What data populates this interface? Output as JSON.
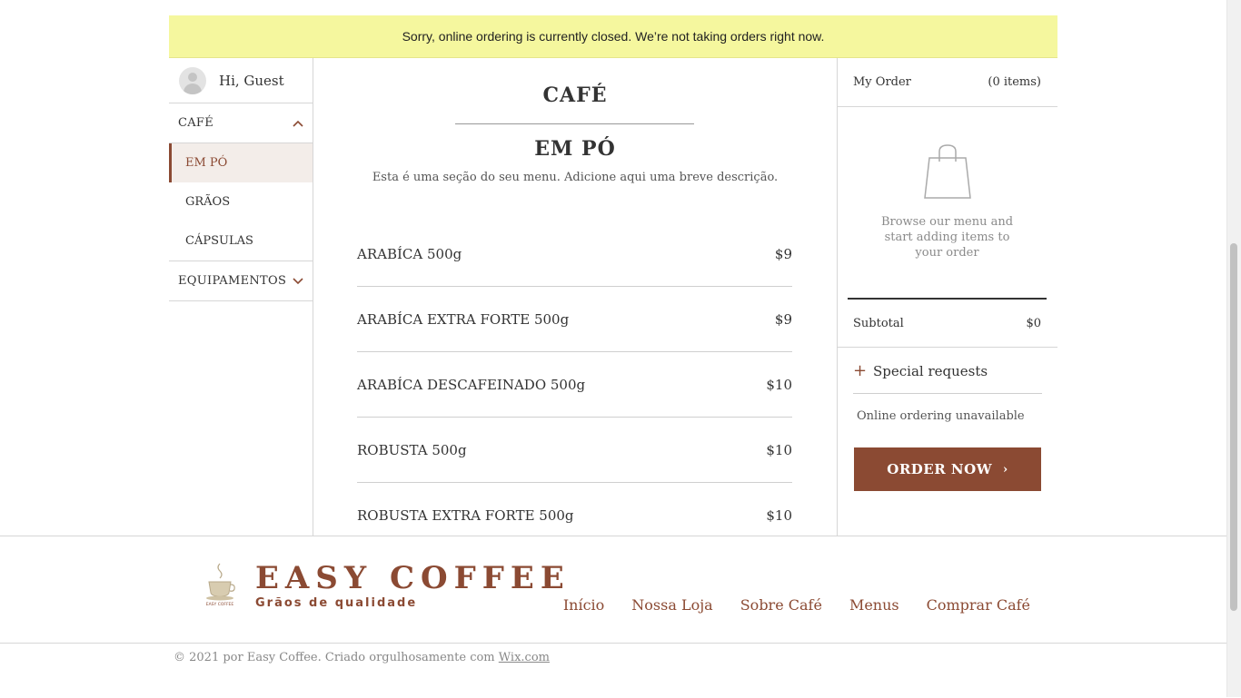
{
  "notice": "Sorry, online ordering is currently closed. We’re not taking orders right now.",
  "sidebar": {
    "greeting": "Hi, Guest",
    "categories": [
      {
        "label": "CAFÉ",
        "expanded": true
      },
      {
        "label": "EQUIPAMENTOS",
        "expanded": false
      }
    ],
    "subitems": [
      {
        "label": "EM PÓ",
        "active": true
      },
      {
        "label": "GRÃOS",
        "active": false
      },
      {
        "label": "CÁPSULAS",
        "active": false
      }
    ]
  },
  "menu": {
    "title": "CAFÉ",
    "section_title": "EM PÓ",
    "section_description": "Esta é uma seção do seu menu. Adicione aqui uma breve descrição.",
    "items": [
      {
        "name": "ARABÍCA 500g",
        "price": "$9"
      },
      {
        "name": "ARABÍCA EXTRA FORTE 500g",
        "price": "$9"
      },
      {
        "name": "ARABÍCA DESCAFEINADO 500g",
        "price": "$10"
      },
      {
        "name": "ROBUSTA 500g",
        "price": "$10"
      },
      {
        "name": "ROBUSTA EXTRA FORTE 500g",
        "price": "$10"
      }
    ]
  },
  "order": {
    "title": "My Order",
    "count": "(0 items)",
    "empty_message": "Browse our menu and start adding items to your order",
    "subtotal_label": "Subtotal",
    "subtotal_value": "$0",
    "special_requests": "Special requests",
    "unavailable": "Online ordering unavailable",
    "order_button": "ORDER NOW"
  },
  "footer": {
    "logo_title": "EASY COFFEE",
    "logo_subtitle": "Grãos de qualidade",
    "logo_small": "EASY COFFEE",
    "nav": [
      "Início",
      "Nossa Loja",
      "Sobre Café",
      "Menus",
      "Comprar Café"
    ],
    "copyright_prefix": "© 2021 por Easy Coffee. Criado orgulhosamente com ",
    "copyright_link": "Wix.com"
  },
  "colors": {
    "brand": "#8b4a33",
    "notice_bg": "#f5f79e",
    "active_bg": "#f3ede9"
  },
  "icons": [
    "user-avatar-icon",
    "chevron-up-icon",
    "chevron-down-icon",
    "shopping-bag-icon",
    "plus-icon",
    "chevron-right-icon",
    "coffee-cup-logo"
  ]
}
